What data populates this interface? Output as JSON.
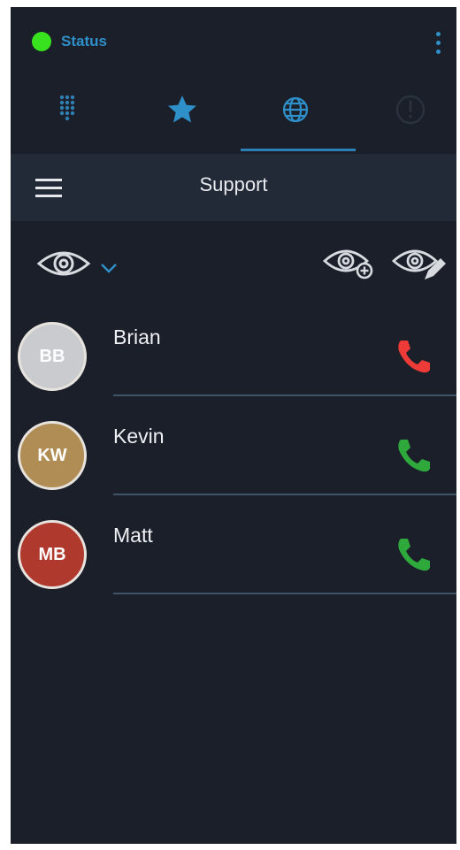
{
  "status": {
    "label": "Status",
    "indicator_color": "#39e21f"
  },
  "tabs": [
    {
      "icon": "dialpad-icon",
      "active": false
    },
    {
      "icon": "star-icon",
      "active": false
    },
    {
      "icon": "globe-icon",
      "active": true
    },
    {
      "icon": "info-icon",
      "active": false
    }
  ],
  "header": {
    "title": "Support",
    "menu_icon": "hamburger-menu-icon"
  },
  "filter": {
    "view_icon": "eye-icon",
    "dropdown_icon": "chevron-down-icon",
    "add_view_icon": "eye-add-icon",
    "edit_view_icon": "eye-edit-icon"
  },
  "contacts": [
    {
      "initials": "BB",
      "name": "Brian",
      "avatar_color": "#c9cbcf",
      "call_status": "busy",
      "call_color": "#ef3b37"
    },
    {
      "initials": "KW",
      "name": "Kevin",
      "avatar_color": "#b08d54",
      "call_status": "available",
      "call_color": "#2fa83c"
    },
    {
      "initials": "MB",
      "name": "Matt",
      "avatar_color": "#b0392e",
      "call_status": "available",
      "call_color": "#2fa83c"
    }
  ],
  "colors": {
    "background": "#1a1f29",
    "header": "#222a37",
    "accent": "#2f8fc9",
    "divider": "#3f5466"
  }
}
